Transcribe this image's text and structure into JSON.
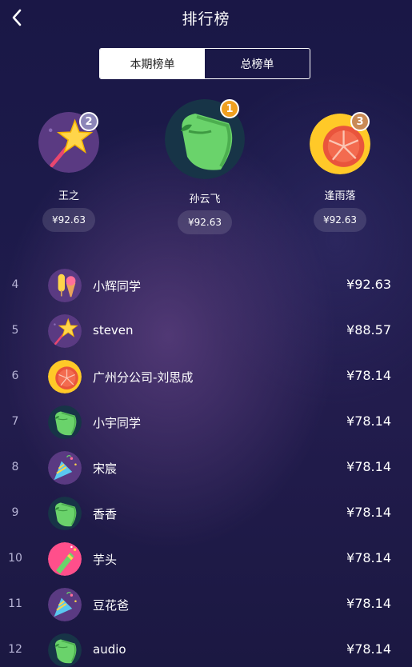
{
  "header": {
    "title": "排行榜"
  },
  "tabs": [
    {
      "label": "本期榜单",
      "active": true
    },
    {
      "label": "总榜单",
      "active": false
    }
  ],
  "podium": [
    {
      "rank": "2",
      "name": "王之",
      "amount": "¥92.63",
      "icon": "star-wand-icon",
      "badge_color": "#8c86b8"
    },
    {
      "rank": "1",
      "name": "孙云飞",
      "amount": "¥92.63",
      "icon": "green-leaf-icon",
      "badge_color": "#f0a020"
    },
    {
      "rank": "3",
      "name": "逢雨落",
      "amount": "¥92.63",
      "icon": "grapefruit-icon",
      "badge_color": "#c98a55"
    }
  ],
  "list": [
    {
      "rank": "4",
      "name": "小辉同学",
      "amount": "¥92.63",
      "icon": "popsicle-icon"
    },
    {
      "rank": "5",
      "name": "steven",
      "amount": "¥88.57",
      "icon": "star-wand-icon"
    },
    {
      "rank": "6",
      "name": "广州分公司-刘思成",
      "amount": "¥78.14",
      "icon": "grapefruit-icon"
    },
    {
      "rank": "7",
      "name": "小宇同学",
      "amount": "¥78.14",
      "icon": "green-leaf-icon"
    },
    {
      "rank": "8",
      "name": "宋宸",
      "amount": "¥78.14",
      "icon": "party-popper-icon"
    },
    {
      "rank": "9",
      "name": "香香",
      "amount": "¥78.14",
      "icon": "green-leaf-icon"
    },
    {
      "rank": "10",
      "name": "芋头",
      "amount": "¥78.14",
      "icon": "champagne-icon"
    },
    {
      "rank": "11",
      "name": "豆花爸",
      "amount": "¥78.14",
      "icon": "party-popper-icon"
    },
    {
      "rank": "12",
      "name": "audio",
      "amount": "¥78.14",
      "icon": "green-leaf-icon"
    }
  ],
  "colors": {
    "background": "#1c1a4a",
    "gold": "#f0a020"
  }
}
